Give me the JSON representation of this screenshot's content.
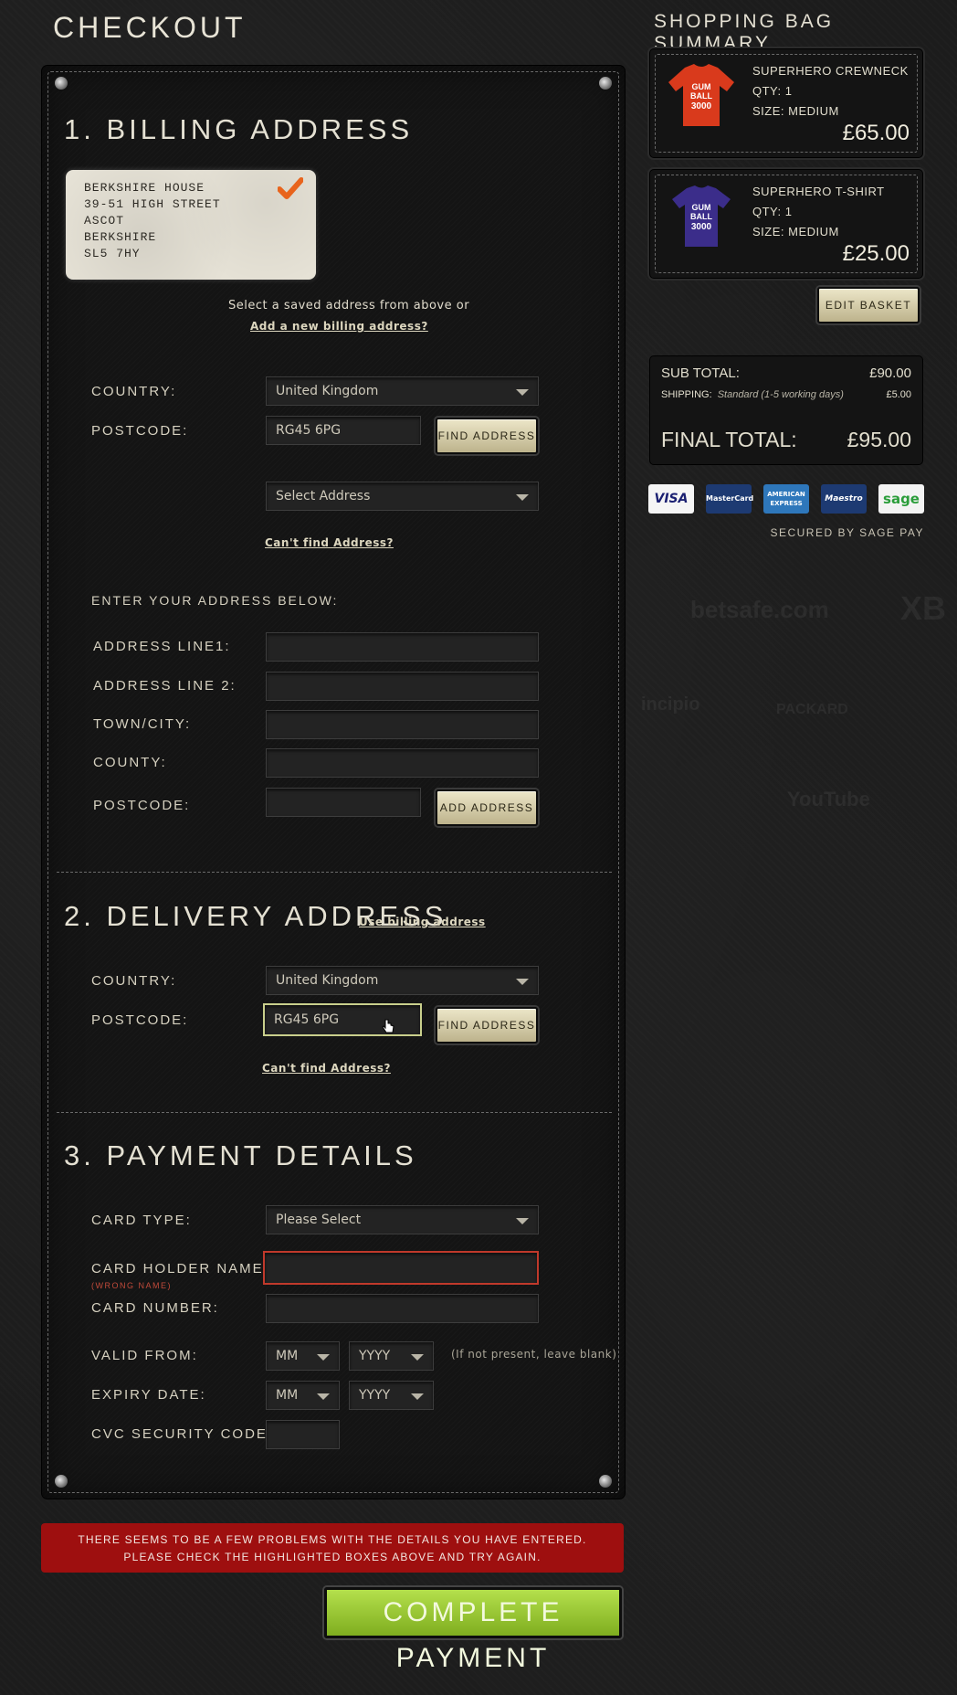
{
  "page": {
    "title": "CHECKOUT"
  },
  "background_logos": [
    "betsafe.com",
    "XB",
    "incipio",
    "PACKARD",
    "YouTube"
  ],
  "billing": {
    "heading": "1. BILLING ADDRESS",
    "saved_address": {
      "lines": [
        "BERKSHIRE HOUSE",
        "39-51 HIGH STREET",
        "ASCOT",
        "BERKSHIRE",
        "SL5 7HY"
      ],
      "selected": true
    },
    "select_hint": "Select a saved address from above or",
    "add_new_link": "Add a new billing address?",
    "country_label": "COUNTRY:",
    "country_value": "United Kingdom",
    "postcode_label": "POSTCODE:",
    "postcode_value": "RG45 6PG",
    "find_address_button": "FIND ADDRESS",
    "select_address_value": "Select Address",
    "cant_find_link": "Can't find Address?",
    "enter_address_heading": "ENTER YOUR ADDRESS BELOW:",
    "address_line1_label": "ADDRESS LINE1:",
    "address_line2_label": "ADDRESS LINE 2:",
    "town_label": "TOWN/CITY:",
    "county_label": "COUNTY:",
    "manual_postcode_label": "POSTCODE:",
    "add_address_button": "ADD ADDRESS"
  },
  "delivery": {
    "heading": "2. DELIVERY ADDRESS",
    "use_billing_link": "Use billing address",
    "country_label": "COUNTRY:",
    "country_value": "United Kingdom",
    "postcode_label": "POSTCODE:",
    "postcode_value": "RG45 6PG",
    "find_address_button": "FIND ADDRESS",
    "cant_find_link": "Can't find Address?"
  },
  "payment": {
    "heading": "3. PAYMENT DETAILS",
    "card_type_label": "CARD TYPE:",
    "card_type_value": "Please Select",
    "holder_label": "CARD HOLDER NAME:",
    "holder_error": "(WRONG NAME)",
    "holder_value": "",
    "card_number_label": "CARD NUMBER:",
    "valid_from_label": "VALID FROM:",
    "valid_from_month": "MM",
    "valid_from_year": "YYYY",
    "valid_from_hint": "(If not present, leave blank)",
    "expiry_label": "EXPIRY DATE:",
    "expiry_month": "MM",
    "expiry_year": "YYYY",
    "cvc_label": "CVC SECURITY CODE:"
  },
  "error_message": {
    "line1": "THERE SEEMS TO BE A FEW PROBLEMS WITH THE DETAILS YOU HAVE ENTERED.",
    "line2": "PLEASE CHECK THE HIGHLIGHTED BOXES ABOVE AND TRY AGAIN."
  },
  "complete_payment_button": "COMPLETE PAYMENT",
  "summary": {
    "title": "SHOPPING BAG SUMMARY",
    "items": [
      {
        "name": "SUPERHERO CREWNECK",
        "qty": "QTY: 1",
        "size": "SIZE: MEDIUM",
        "price": "£65.00",
        "color": "#d93a1c"
      },
      {
        "name": "SUPERHERO T-SHIRT",
        "qty": "QTY: 1",
        "size": "SIZE: MEDIUM",
        "price": "£25.00",
        "color": "#3b2d8a"
      }
    ],
    "thumb_text": [
      "GUM",
      "BALL",
      "3000"
    ],
    "edit_basket_button": "EDIT BASKET",
    "sub_total_label": "SUB TOTAL:",
    "sub_total_value": "£90.00",
    "shipping_label": "SHIPPING:",
    "shipping_method": "Standard (1-5 working days)",
    "shipping_value": "£5.00",
    "final_total_label": "FINAL TOTAL:",
    "final_total_value": "£95.00",
    "card_logos": [
      "VISA",
      "MasterCard",
      "AMERICAN EXPRESS",
      "Maestro",
      "sage"
    ],
    "secured_text": "SECURED BY SAGE PAY"
  },
  "colors": {
    "accent_button": "#d6cfa8",
    "pay_button": "#9ccb34",
    "error": "#9e0f0f",
    "focus_border": "#c9cf8c",
    "error_border": "#c0392b"
  }
}
